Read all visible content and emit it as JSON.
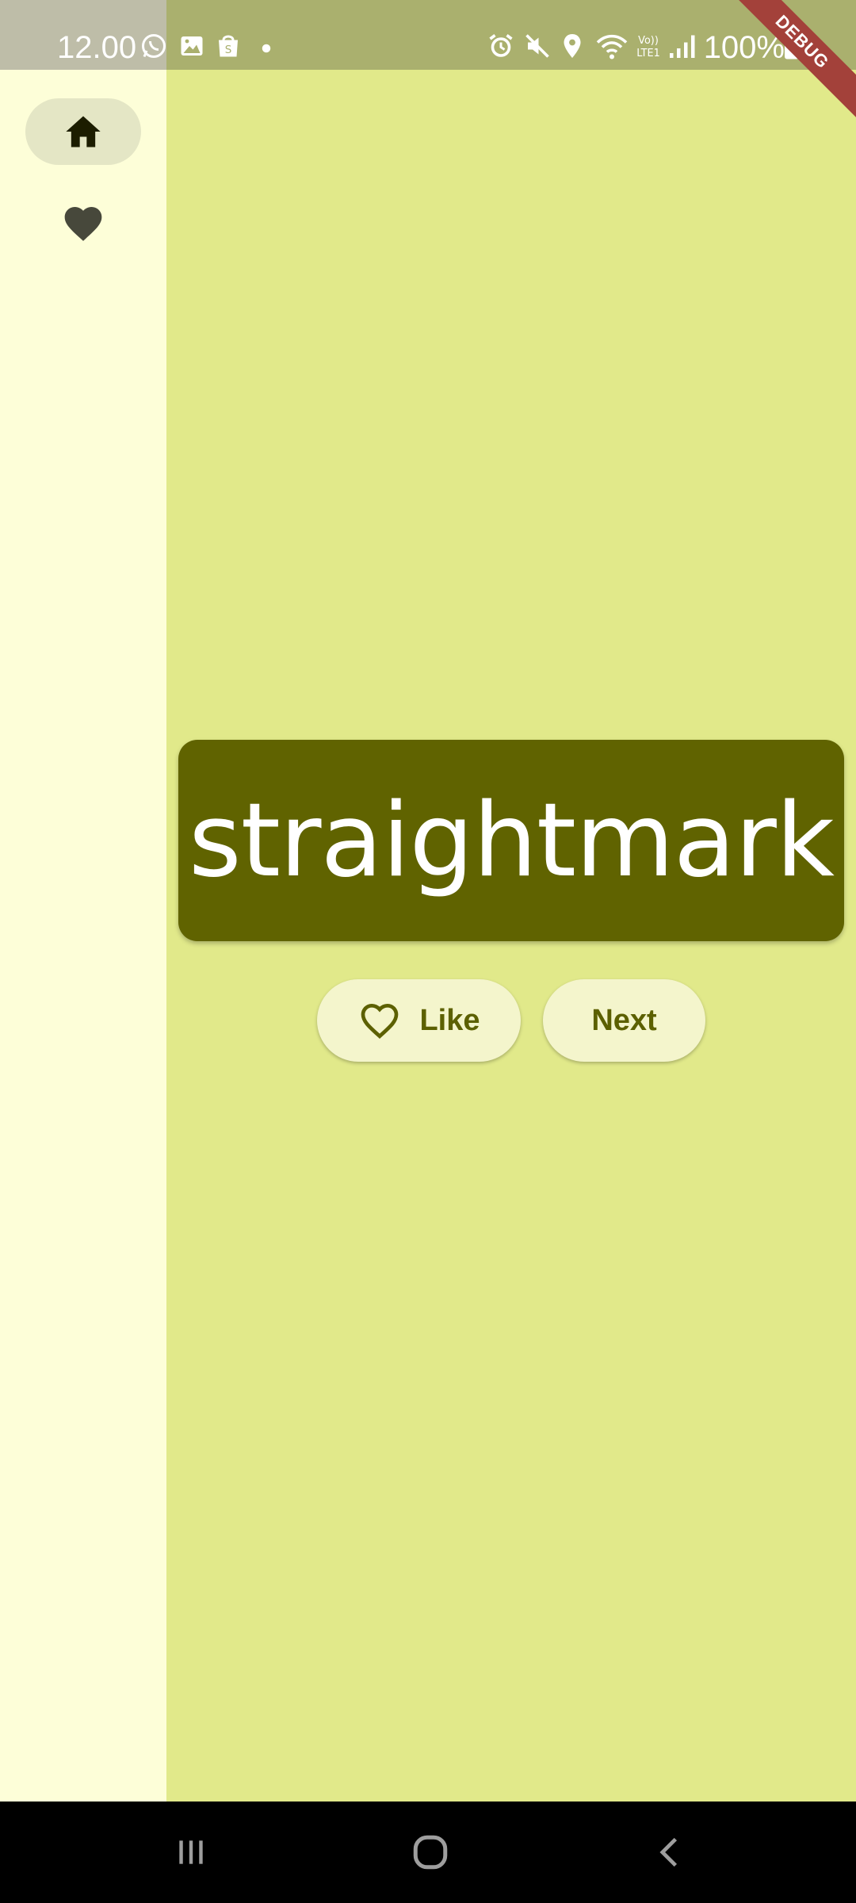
{
  "status_bar": {
    "time": "12.00",
    "battery_percent": "100%",
    "left_icons": [
      "whatsapp-icon",
      "gallery-icon",
      "shopping-bag-icon",
      "dot-icon"
    ],
    "right_icons": [
      "alarm-icon",
      "mute-icon",
      "location-icon",
      "wifi-icon",
      "volte-icon",
      "signal-icon",
      "battery-icon"
    ]
  },
  "debug_banner": "DEBUG",
  "nav_rail": {
    "items": [
      {
        "icon": "home-icon",
        "selected": true
      },
      {
        "icon": "heart-icon",
        "selected": false
      }
    ]
  },
  "main": {
    "word": "straightmark",
    "like_label": "Like",
    "next_label": "Next"
  },
  "colors": {
    "background": "#e1e98a",
    "rail_background": "#fdfed8",
    "card": "#606300",
    "button_bg": "#f4f5cc",
    "button_text": "#5c6000"
  }
}
